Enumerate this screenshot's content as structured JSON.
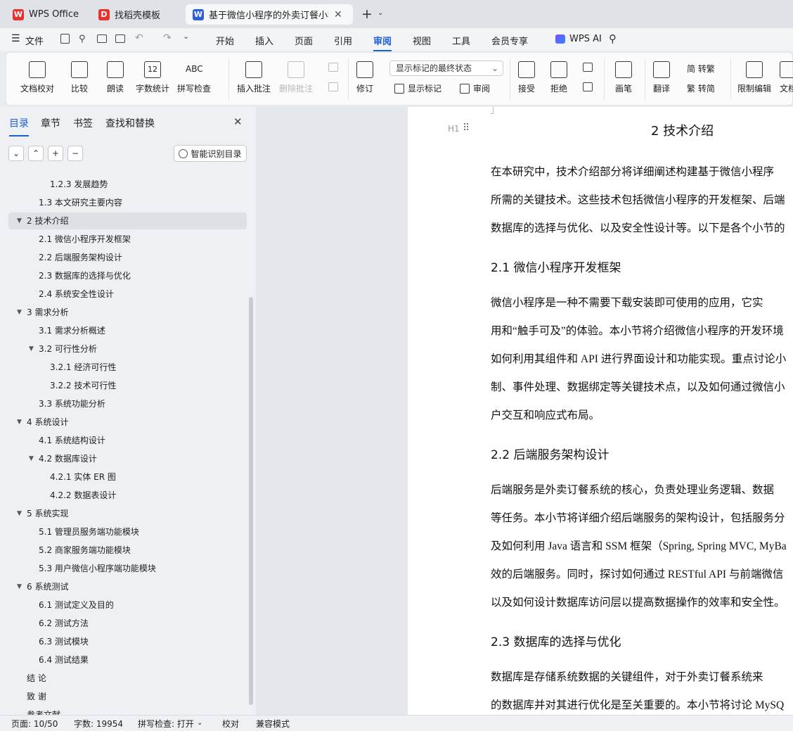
{
  "tabs": [
    {
      "label": "WPS Office",
      "icon": "wps-logo-icon",
      "color": "#e8322d"
    },
    {
      "label": "找稻壳模板",
      "icon": "docer-logo-icon",
      "color": "#e8322d"
    },
    {
      "label": "基于微信小程序的外卖订餐小程序",
      "icon": "wps-writer-icon",
      "color": "#2b5fde"
    }
  ],
  "menu": {
    "file": "文件",
    "items": [
      "开始",
      "插入",
      "页面",
      "引用",
      "审阅",
      "视图",
      "工具",
      "会员专享"
    ],
    "active": "审阅",
    "ai": "WPS AI"
  },
  "ribbon": {
    "big": [
      "文档校对",
      "比较",
      "朗读",
      "字数统计",
      "拼写检查",
      "插入批注",
      "删除批注",
      "修订",
      "接受",
      "拒绝",
      "画笔",
      "限制编辑",
      "文档"
    ],
    "select_value": "显示标记的最终状态",
    "show_markup": "显示标记",
    "review": "审阅",
    "translate": "翻译",
    "to_trad": "简 转繁",
    "to_simp": "繁 转简",
    "abc": "ABC",
    "num": "12"
  },
  "panel": {
    "tabs": [
      "目录",
      "章节",
      "书签",
      "查找和替换"
    ],
    "smart_button": "智能识别目录",
    "toc": [
      {
        "text": "1.2.3  发展趋势",
        "level": 3
      },
      {
        "text": "1.3  本文研究主要内容",
        "level": 2
      },
      {
        "text": "2  技术介绍",
        "level": 1,
        "arrow": true,
        "selected": true
      },
      {
        "text": "2.1  微信小程序开发框架",
        "level": 2
      },
      {
        "text": "2.2  后端服务架构设计",
        "level": 2
      },
      {
        "text": "2.3  数据库的选择与优化",
        "level": 2
      },
      {
        "text": "2.4  系统安全性设计",
        "level": 2
      },
      {
        "text": "3  需求分析",
        "level": 1,
        "arrow": true
      },
      {
        "text": "3.1  需求分析概述",
        "level": 2
      },
      {
        "text": "3.2  可行性分析",
        "level": 2,
        "arrow": true
      },
      {
        "text": "3.2.1  经济可行性",
        "level": 3
      },
      {
        "text": "3.2.2  技术可行性",
        "level": 3
      },
      {
        "text": "3.3  系统功能分析",
        "level": 2
      },
      {
        "text": "4  系统设计",
        "level": 1,
        "arrow": true
      },
      {
        "text": "4.1 系统结构设计",
        "level": 2
      },
      {
        "text": "4.2  数据库设计",
        "level": 2,
        "arrow": true
      },
      {
        "text": "4.2.1  实体 ER 图",
        "level": 3
      },
      {
        "text": "4.2.2  数据表设计",
        "level": 3
      },
      {
        "text": "5  系统实现",
        "level": 1,
        "arrow": true
      },
      {
        "text": "5.1  管理员服务端功能模块",
        "level": 2
      },
      {
        "text": "5.2  商家服务端功能模块",
        "level": 2
      },
      {
        "text": "5.3 用户微信小程序端功能模块",
        "level": 2
      },
      {
        "text": " 6  系统测试",
        "level": 1,
        "arrow": true
      },
      {
        "text": "6.1  测试定义及目的",
        "level": 2
      },
      {
        "text": "6.2  测试方法",
        "level": 2
      },
      {
        "text": "6.3  测试模块",
        "level": 2
      },
      {
        "text": "6.4  测试结果",
        "level": 2
      },
      {
        "text": "结    论",
        "level": 0
      },
      {
        "text": "致    谢",
        "level": 0
      },
      {
        "text": "参考文献",
        "level": 0
      }
    ]
  },
  "document": {
    "chapter_title": "2  技术介绍",
    "heading_marker": "H1",
    "lines": [
      {
        "type": "p",
        "text": "        在本研究中，技术介绍部分将详细阐述构建基于微信小程序"
      },
      {
        "type": "p",
        "text": "所需的关键技术。这些技术包括微信小程序的开发框架、后端"
      },
      {
        "type": "p",
        "text": "数据库的选择与优化、以及安全性设计等。以下是各个小节的"
      },
      {
        "type": "h",
        "text": "2.1  微信小程序开发框架"
      },
      {
        "type": "p",
        "text": "        微信小程序是一种不需要下载安装即可使用的应用，它实"
      },
      {
        "type": "p",
        "text": "用和“触手可及”的体验。本小节将介绍微信小程序的开发环境"
      },
      {
        "type": "p",
        "text": "如何利用其组件和 API 进行界面设计和功能实现。重点讨论小"
      },
      {
        "type": "p",
        "text": "制、事件处理、数据绑定等关键技术点，以及如何通过微信小"
      },
      {
        "type": "p",
        "text": "户交互和响应式布局。"
      },
      {
        "type": "h",
        "text": "2.2  后端服务架构设计"
      },
      {
        "type": "p",
        "text": "        后端服务是外卖订餐系统的核心，负责处理业务逻辑、数据"
      },
      {
        "type": "p",
        "text": "等任务。本小节将详细介绍后端服务的架构设计，包括服务分"
      },
      {
        "type": "p",
        "text": "及如何利用 Java 语言和 SSM 框架（Spring, Spring MVC, MyBa"
      },
      {
        "type": "p",
        "text": "效的后端服务。同时，探讨如何通过 RESTful API 与前端微信"
      },
      {
        "type": "p",
        "text": "以及如何设计数据库访问层以提高数据操作的效率和安全性。"
      },
      {
        "type": "h",
        "text": "2.3  数据库的选择与优化"
      },
      {
        "type": "p",
        "text": "        数据库是存储系统数据的关键组件，对于外卖订餐系统来"
      },
      {
        "type": "p",
        "text": "的数据库并对其进行优化是至关重要的。本小节将讨论 MySQ"
      }
    ]
  },
  "status": {
    "page": "页面: 10/50",
    "words": "字数: 19954",
    "spell": "拼写检查: 打开",
    "proof": "校对",
    "compat": "兼容模式"
  }
}
